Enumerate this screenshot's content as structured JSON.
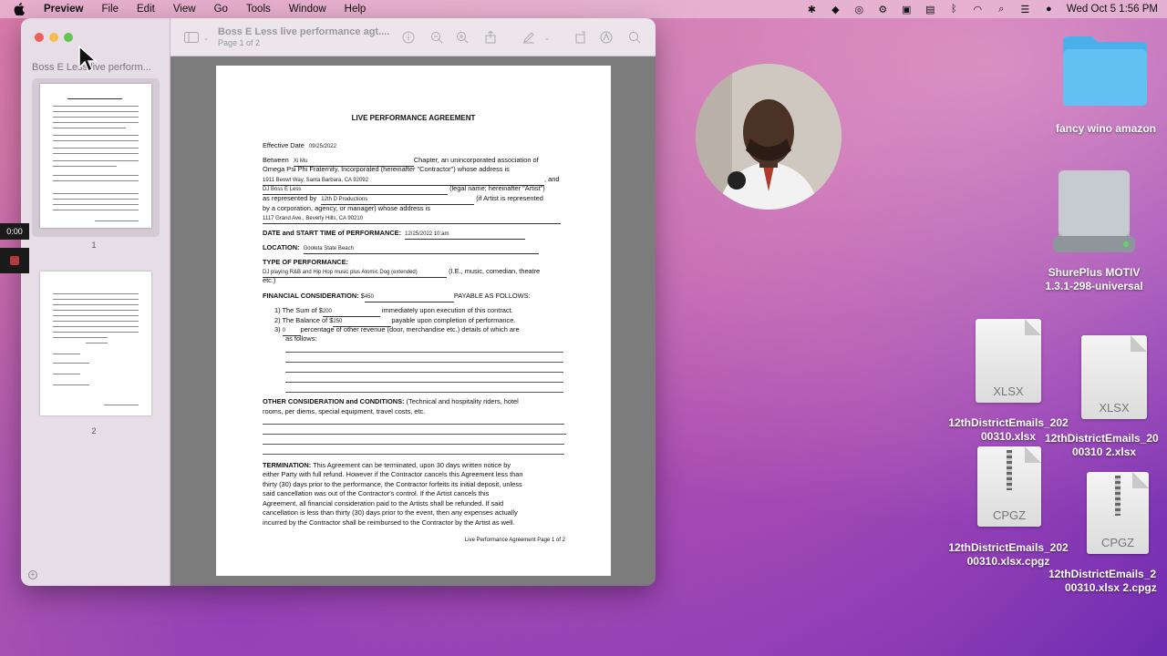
{
  "menubar": {
    "app": "Preview",
    "items": [
      "File",
      "Edit",
      "View",
      "Go",
      "Tools",
      "Window",
      "Help"
    ],
    "clock": "Wed Oct 5  1:56 PM"
  },
  "window": {
    "sidebar_title": "Boss E Less live perform...",
    "doc_title": "Boss E Less live performance agt....",
    "doc_subtitle": "Page 1 of 2",
    "pages": [
      "1",
      "2"
    ]
  },
  "recording": {
    "timer": "0:00"
  },
  "document": {
    "heading": "LIVE PERFORMANCE AGREEMENT",
    "effective_label": "Effective Date",
    "effective_value": "09/25/2022",
    "between_label": "Between",
    "between_value": "Xi Mu",
    "chapter_text": "Chapter, an unincorporated association of",
    "line_omega": "Omega Psi Phi Fraternity, Incorporated (hereinafter \"Contractor\") whose address is",
    "address1": "1911 Beowt Way, Santa Barbara, CA 92092",
    "and_text": ", and",
    "artist_value": "DJ Boss E Less",
    "artist_text": "(legal name; hereinafter \"Artist\")",
    "represented_label": "as represented by",
    "represented_value": "12th D Productions",
    "represented_text": "(if Artist is represented",
    "line_corp": "by a corporation, agency, or manager) whose address is",
    "address2": "1117 Grand Ave., Beverly Hills, CA  90210",
    "date_label": "DATE and START TIME of PERFORMANCE:",
    "date_value": "12/25/2022 10:am",
    "location_label": "LOCATION:",
    "location_value": "Gooleta State Beach",
    "type_label": "TYPE OF PERFORMANCE:",
    "type_value": "DJ playing R&B and Hip Hop music plus Atomic Dog (extended)",
    "type_text": "(I.E., music, comedian, theatre",
    "type_etc": "etc.)",
    "fin_label": "FINANCIAL CONSIDERATION:",
    "fin_dollar": "$",
    "fin_value": "450",
    "fin_text": "PAYABLE AS FOLLOWS:",
    "item1_a": "1)  The Sum of $",
    "item1_v": "200",
    "item1_b": "immediately upon execution of this contract.",
    "item2_a": "2)  The Balance of $",
    "item2_v": "250",
    "item2_b": "payable upon completion of performance.",
    "item3_a": "3)",
    "item3_v": "0",
    "item3_b": "percentage of other revenue (door, merchandise etc.) details of which are",
    "item3_c": "as follows:",
    "other_label": "OTHER CONSIDERATION and CONDITIONS:",
    "other_text": "(Technical and hospitality riders, hotel",
    "other_text2": "rooms, per diems, special equipment, travel costs, etc.",
    "term_label": "TERMINATION:",
    "term_lines": [
      "This Agreement can be terminated, upon 30 days written notice by",
      "either Party with full refund. However if the Contractor cancels this Agreement less than",
      "thirty (30) days prior to the performance, the Contractor forfeits its initial deposit, unless",
      "said cancellation was out of the Contractor's control.  If the Artist cancels this",
      "Agreement, all financial consideration paid to the Artists shall be refunded.  If said",
      "cancellation is less than thirty (30) days prior to the event, then any expenses actually",
      "incurred by the Contractor shall be reimbursed to the Contractor by the Artist as well."
    ],
    "footer": "Live Performance Agreement Page 1 of 2"
  },
  "desktop": {
    "folder_label": "fancy wino  amazon",
    "drive_label_1": "ShurePlus MOTIV",
    "drive_label_2": "1.3.1-298-universal",
    "xlsx_ext": "XLSX",
    "cpgz_ext": "CPGZ",
    "file1_l1": "12thDistrictEmails_202",
    "file1_l2": "00310.xlsx",
    "file2_l1": "12thDistrictEmails_20",
    "file2_l2": "00310 2.xlsx",
    "file3_l1": "12thDistrictEmails_202",
    "file3_l2": "00310.xlsx.cpgz",
    "file4_l1": "12thDistrictEmails_2",
    "file4_l2": "00310.xlsx 2.cpgz"
  }
}
